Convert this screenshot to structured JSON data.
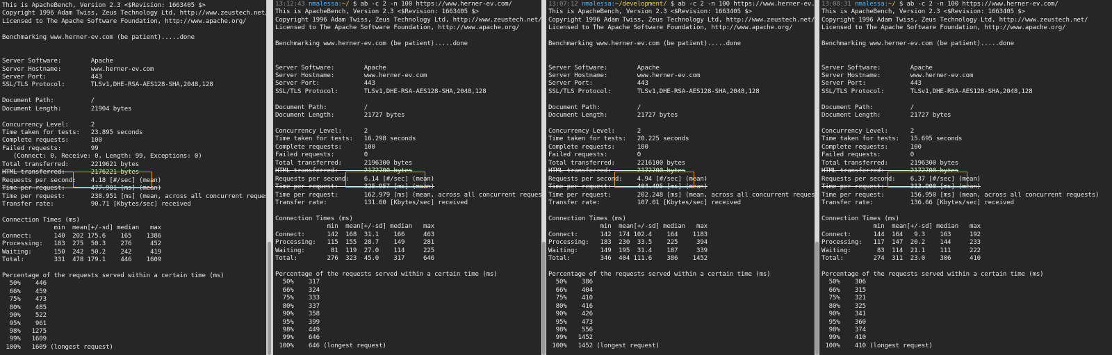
{
  "colors": {
    "background": "#262626",
    "text": "#e6e6e6",
    "highlight": "#e8a020",
    "user_host": "#4fb3ff",
    "path": "#f2d04a",
    "timestamp": "#8a8a8a"
  },
  "panes": [
    {
      "prompt": null,
      "lines": [
        "This is ApacheBench, Version 2.3 <$Revision: 1663405 $>",
        "Copyright 1996 Adam Twiss, Zeus Technology Ltd, http://www.zeustech.net/",
        "Licensed to The Apache Software Foundation, http://www.apache.org/",
        "",
        "Benchmarking www.herner-ev.com (be patient).....done",
        "",
        "",
        "Server Software:        Apache",
        "Server Hostname:        www.herner-ev.com",
        "Server Port:            443",
        "SSL/TLS Protocol:       TLSv1,DHE-RSA-AES128-SHA,2048,128",
        "",
        "Document Path:          /",
        "Document Length:        21904 bytes",
        "",
        "Concurrency Level:      2",
        "Time taken for tests:   23.895 seconds",
        "Complete requests:      100",
        "Failed requests:        99",
        "   (Connect: 0, Receive: 0, Length: 99, Exceptions: 0)",
        "Total transferred:      2219621 bytes",
        "HTML transferred:       2176221 bytes",
        "Requests per second:    4.18 [#/sec] (mean)",
        "Time per request:       477.901 [ms] (mean)",
        "Time per request:       238.951 [ms] (mean, across all concurrent requests)",
        "Transfer rate:          90.71 [Kbytes/sec] received",
        "",
        "Connection Times (ms)",
        "              min  mean[+/-sd] median   max",
        "Connect:      140  202 175.6    165    1386",
        "Processing:   183  275  50.3    276     452",
        "Waiting:      150  242  50.2    242     419",
        "Total:        331  478 179.1    446    1609",
        "",
        "Percentage of the requests served within a certain time (ms)",
        "  50%    446",
        "  66%    459",
        "  75%    473",
        "  80%    485",
        "  90%    522",
        "  95%    961",
        "  98%   1275",
        "  99%   1609",
        " 100%   1609 (longest request)"
      ]
    },
    {
      "prompt": {
        "time": "13:12:43",
        "userhost": "nmalessa:",
        "path": "~/",
        "command": " $ ab -c 2 -n 100 https://www.herner-ev.com/"
      },
      "lines": [
        "This is ApacheBench, Version 2.3 <$Revision: 1663405 $>",
        "Copyright 1996 Adam Twiss, Zeus Technology Ltd, http://www.zeustech.net/",
        "Licensed to The Apache Software Foundation, http://www.apache.org/",
        "",
        "Benchmarking www.herner-ev.com (be patient).....done",
        "",
        "",
        "Server Software:        Apache",
        "Server Hostname:        www.herner-ev.com",
        "Server Port:            443",
        "SSL/TLS Protocol:       TLSv1,DHE-RSA-AES128-SHA,2048,128",
        "",
        "Document Path:          /",
        "Document Length:        21727 bytes",
        "",
        "Concurrency Level:      2",
        "Time taken for tests:   16.298 seconds",
        "Complete requests:      100",
        "Failed requests:        0",
        "Total transferred:      2196300 bytes",
        "HTML transferred:       2172700 bytes",
        "Requests per second:    6.14 [#/sec] (mean)",
        "Time per request:       325.957 [ms] (mean)",
        "Time per request:       162.979 [ms] (mean, across all concurrent requests)",
        "Transfer rate:          131.60 [Kbytes/sec] received",
        "",
        "Connection Times (ms)",
        "              min  mean[+/-sd] median   max",
        "Connect:      142  168  31.1    166     463",
        "Processing:   115  155  28.7    149     281",
        "Waiting:       81  119  27.0    114     225",
        "Total:        276  323  45.0    317     646",
        "",
        "Percentage of the requests served within a certain time (ms)",
        "  50%    317",
        "  66%    324",
        "  75%    333",
        "  80%    337",
        "  90%    358",
        "  95%    399",
        "  98%    449",
        "  99%    646",
        " 100%    646 (longest request)"
      ]
    },
    {
      "prompt": {
        "time": "13:07:12",
        "userhost": "nmalessa:",
        "path": "~/development/",
        "command": " $ ab -c 2 -n 100 https://www.herner-ev.com/"
      },
      "lines": [
        "This is ApacheBench, Version 2.3 <$Revision: 1663405 $>",
        "Copyright 1996 Adam Twiss, Zeus Technology Ltd, http://www.zeustech.net/",
        "Licensed to The Apache Software Foundation, http://www.apache.org/",
        "",
        "Benchmarking www.herner-ev.com (be patient).....done",
        "",
        "",
        "Server Software:        Apache",
        "Server Hostname:        www.herner-ev.com",
        "Server Port:            443",
        "SSL/TLS Protocol:       TLSv1,DHE-RSA-AES128-SHA,2048,128",
        "",
        "Document Path:          /",
        "Document Length:        21727 bytes",
        "",
        "Concurrency Level:      2",
        "Time taken for tests:   20.225 seconds",
        "Complete requests:      100",
        "Failed requests:        0",
        "Total transferred:      2216100 bytes",
        "HTML transferred:       2172700 bytes",
        "Requests per second:    4.94 [#/sec] (mean)",
        "Time per request:       404.495 [ms] (mean)",
        "Time per request:       202.248 [ms] (mean, across all concurrent requests)",
        "Transfer rate:          107.01 [Kbytes/sec] received",
        "",
        "Connection Times (ms)",
        "              min  mean[+/-sd] median   max",
        "Connect:      142  174 102.4    164    1183",
        "Processing:   183  230  33.5    225     394",
        "Waiting:      149  195  31.4    187     339",
        "Total:        346  404 111.6    386    1452",
        "",
        "Percentage of the requests served within a certain time (ms)",
        "  50%    386",
        "  66%    404",
        "  75%    410",
        "  80%    416",
        "  90%    426",
        "  95%    473",
        "  98%    556",
        "  99%   1452",
        " 100%   1452 (longest request)"
      ]
    },
    {
      "prompt": {
        "time": "13:08:31",
        "userhost": "nmalessa:",
        "path": "~/",
        "command": " $ ab -c 2 -n 100 https://www.herner-ev.com/"
      },
      "lines": [
        "This is ApacheBench, Version 2.3 <$Revision: 1663405 $>",
        "Copyright 1996 Adam Twiss, Zeus Technology Ltd, http://www.zeustech.net/",
        "Licensed to The Apache Software Foundation, http://www.apache.org/",
        "",
        "Benchmarking www.herner-ev.com (be patient).....done",
        "",
        "",
        "Server Software:        Apache",
        "Server Hostname:        www.herner-ev.com",
        "Server Port:            443",
        "SSL/TLS Protocol:       TLSv1,DHE-RSA-AES128-SHA,2048,128",
        "",
        "Document Path:          /",
        "Document Length:        21727 bytes",
        "",
        "Concurrency Level:      2",
        "Time taken for tests:   15.695 seconds",
        "Complete requests:      100",
        "Failed requests:        0",
        "Total transferred:      2196300 bytes",
        "HTML transferred:       2172700 bytes",
        "Requests per second:    6.37 [#/sec] (mean)",
        "Time per request:       313.900 [ms] (mean)",
        "Time per request:       156.950 [ms] (mean, across all concurrent requests)",
        "Transfer rate:          136.66 [Kbytes/sec] received",
        "",
        "Connection Times (ms)",
        "              min  mean[+/-sd] median   max",
        "Connect:      144  164   9.3    163     192",
        "Processing:   117  147  20.2    144     233",
        "Waiting:       83  114  21.1    111     222",
        "Total:        274  311  23.0    306     410",
        "",
        "Percentage of the requests served within a certain time (ms)",
        "  50%    306",
        "  66%    315",
        "  75%    321",
        "  80%    325",
        "  90%    341",
        "  95%    360",
        "  98%    374",
        "  99%    410",
        " 100%    410 (longest request)"
      ]
    }
  ]
}
